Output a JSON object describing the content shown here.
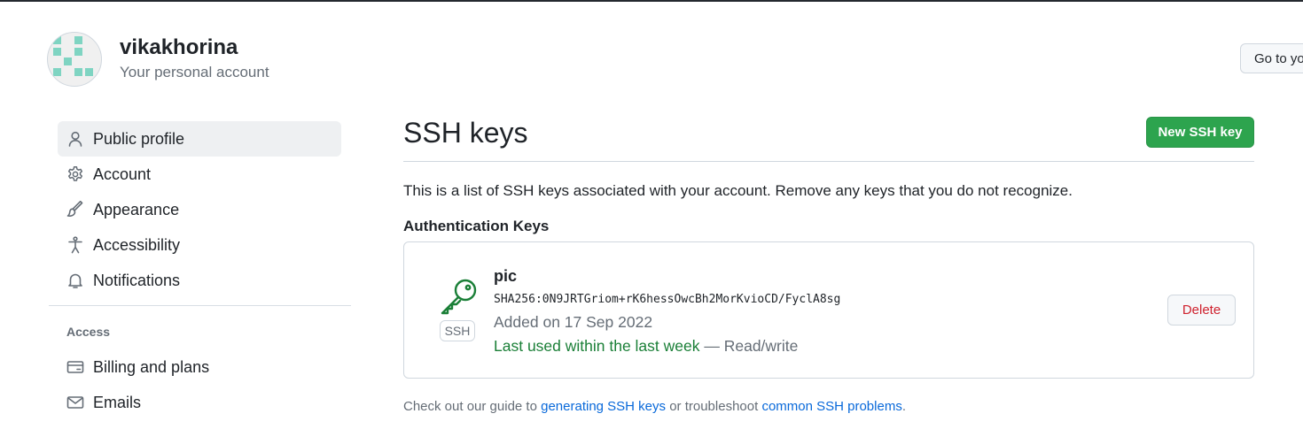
{
  "account": {
    "username": "vikakhorina",
    "subtitle": "Your personal account",
    "go_to_button": "Go to yo"
  },
  "sidebar": {
    "items": [
      {
        "label": "Public profile",
        "icon": "person-icon",
        "active": true
      },
      {
        "label": "Account",
        "icon": "gear-icon"
      },
      {
        "label": "Appearance",
        "icon": "paintbrush-icon"
      },
      {
        "label": "Accessibility",
        "icon": "accessibility-icon"
      },
      {
        "label": "Notifications",
        "icon": "bell-icon"
      }
    ],
    "access_heading": "Access",
    "access_items": [
      {
        "label": "Billing and plans",
        "icon": "credit-card-icon"
      },
      {
        "label": "Emails",
        "icon": "mail-icon"
      }
    ]
  },
  "main": {
    "title": "SSH keys",
    "new_key_button": "New SSH key",
    "intro": "This is a list of SSH keys associated with your account. Remove any keys that you do not recognize.",
    "section_heading": "Authentication Keys",
    "keys": [
      {
        "title": "pic",
        "type_label": "SSH",
        "icon": "key-icon",
        "fingerprint": "SHA256:0N9JRTGriom+rK6hessOwcBh2MorKvioCD/FyclA8sg",
        "added": "Added on 17 Sep 2022",
        "last_used": "Last used within the last week",
        "access": " — Read/write",
        "delete_button": "Delete"
      }
    ],
    "footer": {
      "prefix": "Check out our guide to ",
      "link1": "generating SSH keys",
      "middle": " or troubleshoot ",
      "link2": "common SSH problems",
      "suffix": "."
    }
  },
  "colors": {
    "primary_button": "#2da44e",
    "danger": "#cf222e",
    "success_text": "#1a7f37",
    "link": "#0969da",
    "key_icon": "#1a7f37"
  }
}
